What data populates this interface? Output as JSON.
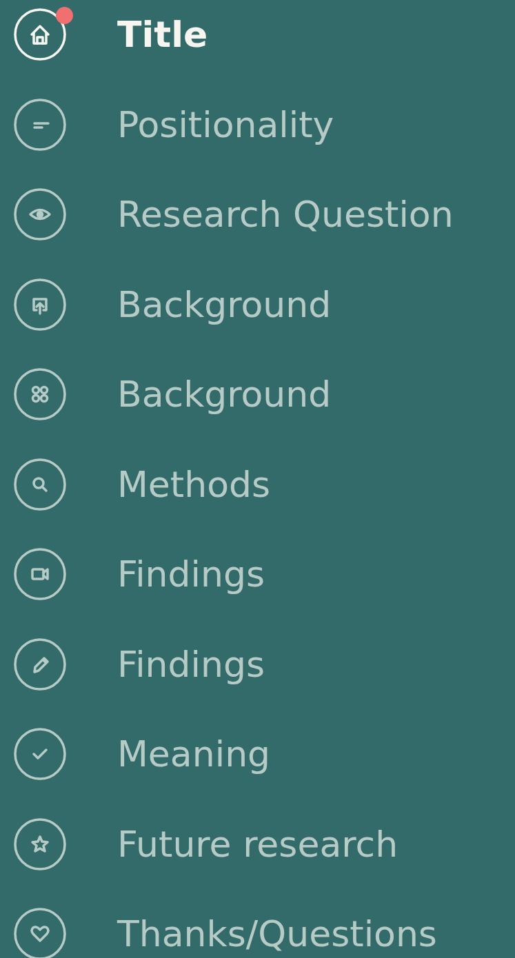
{
  "menu": [
    {
      "kind": "home",
      "label": "Title",
      "selected": true,
      "notification": true
    },
    {
      "kind": "lines",
      "label": "Positionality",
      "selected": false,
      "notification": false
    },
    {
      "kind": "eye",
      "label": "Research Question",
      "selected": false,
      "notification": false
    },
    {
      "kind": "share",
      "label": "Background",
      "selected": false,
      "notification": false
    },
    {
      "kind": "grid",
      "label": "Background",
      "selected": false,
      "notification": false
    },
    {
      "kind": "search",
      "label": "Methods",
      "selected": false,
      "notification": false
    },
    {
      "kind": "video",
      "label": "Findings",
      "selected": false,
      "notification": false
    },
    {
      "kind": "pencil",
      "label": "Findings",
      "selected": false,
      "notification": false
    },
    {
      "kind": "check",
      "label": "Meaning",
      "selected": false,
      "notification": false
    },
    {
      "kind": "star",
      "label": "Future research",
      "selected": false,
      "notification": false
    },
    {
      "kind": "heart",
      "label": "Thanks/Questions",
      "selected": false,
      "notification": false
    }
  ]
}
